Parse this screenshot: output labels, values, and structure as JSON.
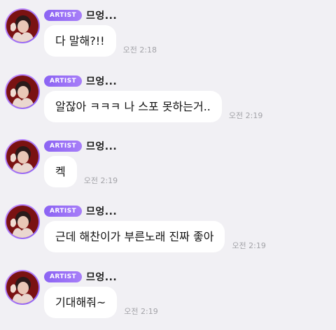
{
  "badge_label": "ARTIST",
  "sender_name": "므엉...",
  "avatar_icon": "profile-photo",
  "colors": {
    "background": "#f1f0f4",
    "bubble": "#ffffff",
    "badge": "#8b63f3",
    "timestamp": "#a3a3a8"
  },
  "messages": [
    {
      "text": "다 말해?!!",
      "time": "오전 2:18"
    },
    {
      "text": "알잖아 ㅋㅋㅋ 나 스포 못하는거..",
      "time": "오전 2:19"
    },
    {
      "text": "켁",
      "time": "오전 2:19"
    },
    {
      "text": "근데 해찬이가 부른노래 진짜 좋아",
      "time": "오전 2:19"
    },
    {
      "text": "기대해줘~",
      "time": "오전 2:19"
    }
  ]
}
